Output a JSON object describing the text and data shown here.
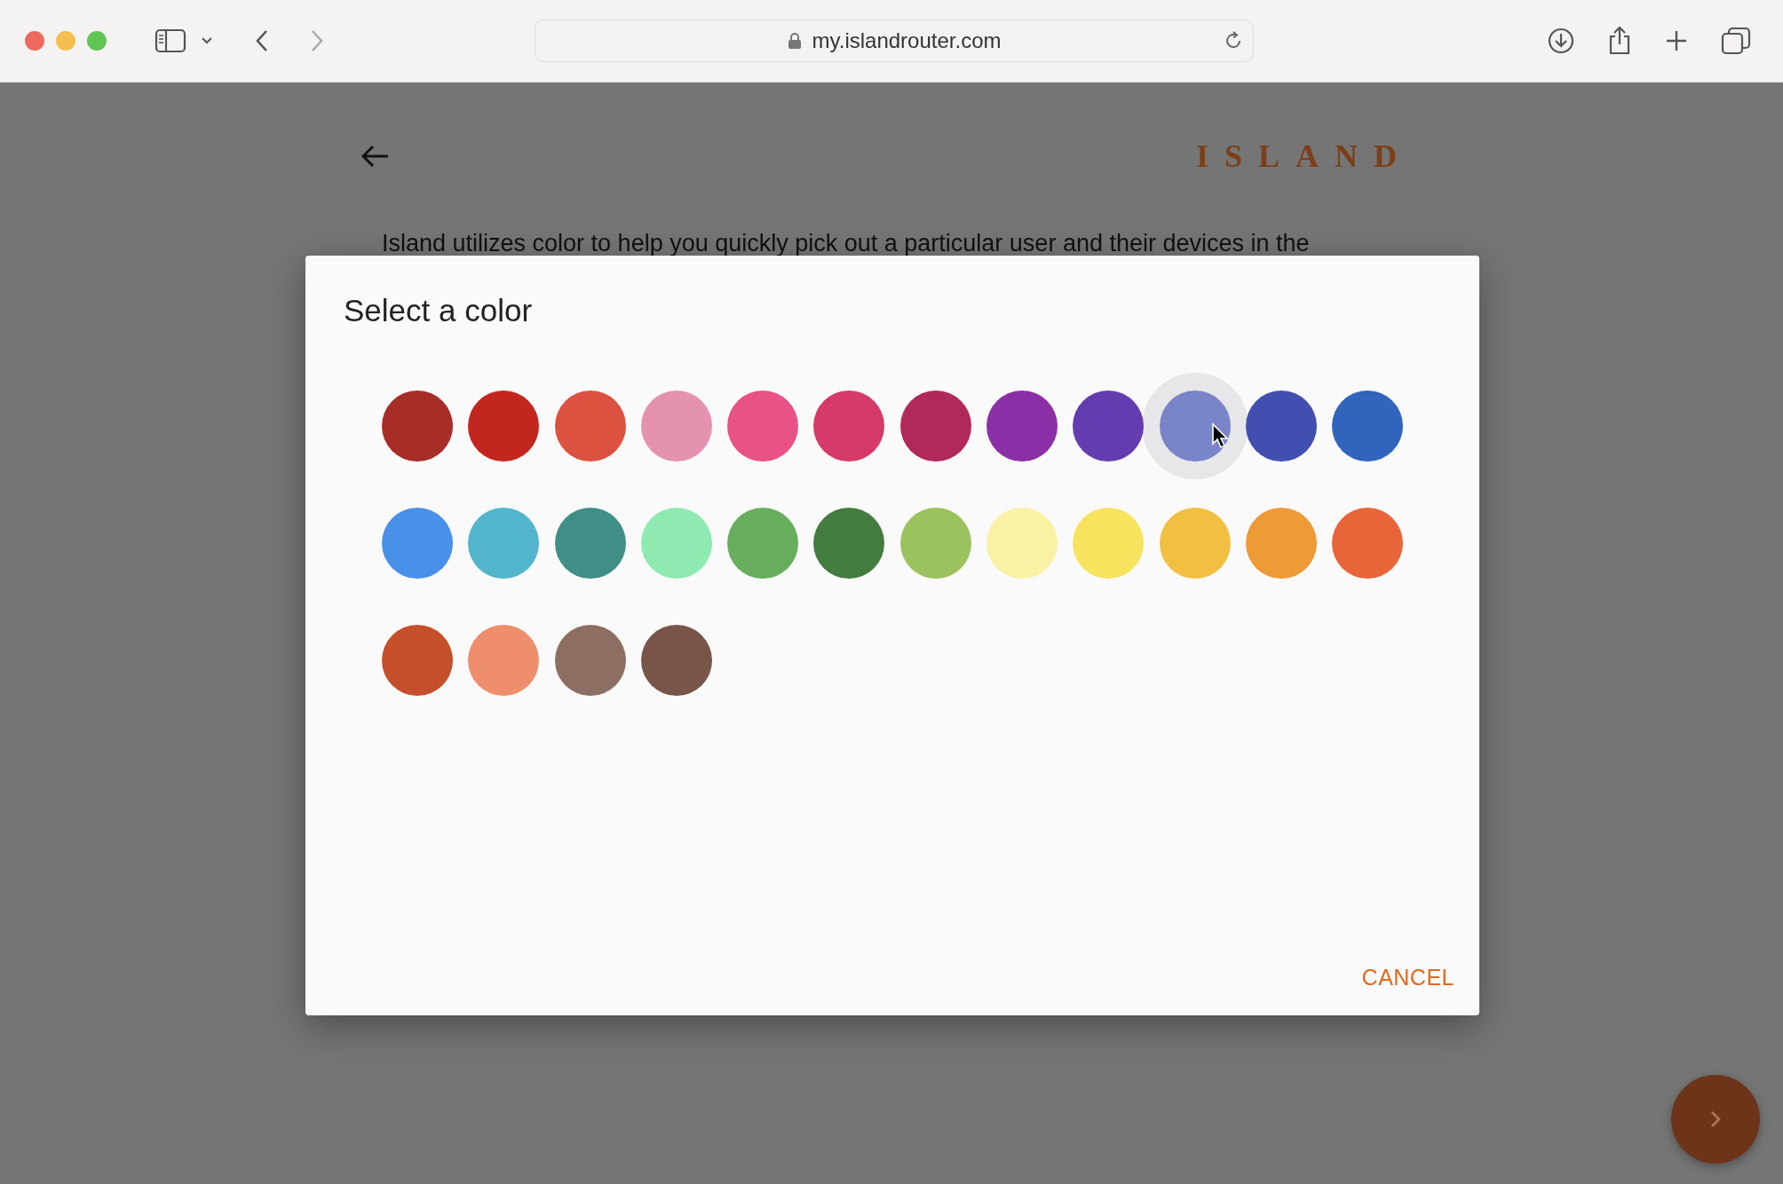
{
  "browser": {
    "url": "my.islandrouter.com"
  },
  "page": {
    "logo": "ISLAND",
    "intro": "Island utilizes color to help you quickly pick out a particular user and their devices in the"
  },
  "dialog": {
    "title": "Select a color",
    "swatches": [
      {
        "color": "#a82c28",
        "hovered": false
      },
      {
        "color": "#c3261f",
        "hovered": false
      },
      {
        "color": "#dc5240",
        "hovered": false
      },
      {
        "color": "#e492b0",
        "hovered": false
      },
      {
        "color": "#e95287",
        "hovered": false
      },
      {
        "color": "#d63a68",
        "hovered": false
      },
      {
        "color": "#b0295a",
        "hovered": false
      },
      {
        "color": "#8b2fa6",
        "hovered": false
      },
      {
        "color": "#633db0",
        "hovered": false
      },
      {
        "color": "#7a84c8",
        "hovered": true
      },
      {
        "color": "#4150b0",
        "hovered": false
      },
      {
        "color": "#3064bd",
        "hovered": false
      },
      {
        "color": "#4990e8",
        "hovered": false
      },
      {
        "color": "#52b5cc",
        "hovered": false
      },
      {
        "color": "#3f8f86",
        "hovered": false
      },
      {
        "color": "#8eeab0",
        "hovered": false
      },
      {
        "color": "#66ad5c",
        "hovered": false
      },
      {
        "color": "#437c3e",
        "hovered": false
      },
      {
        "color": "#9bc25e",
        "hovered": false
      },
      {
        "color": "#f9f1a4",
        "hovered": false
      },
      {
        "color": "#f7e35e",
        "hovered": false
      },
      {
        "color": "#f1bf42",
        "hovered": false
      },
      {
        "color": "#ee9a36",
        "hovered": false
      },
      {
        "color": "#e8653a",
        "hovered": false
      },
      {
        "color": "#c44f2a",
        "hovered": false
      },
      {
        "color": "#ee8e6c",
        "hovered": false
      },
      {
        "color": "#8d6e62",
        "hovered": false
      },
      {
        "color": "#775649",
        "hovered": false
      }
    ],
    "cancel": "CANCEL"
  }
}
